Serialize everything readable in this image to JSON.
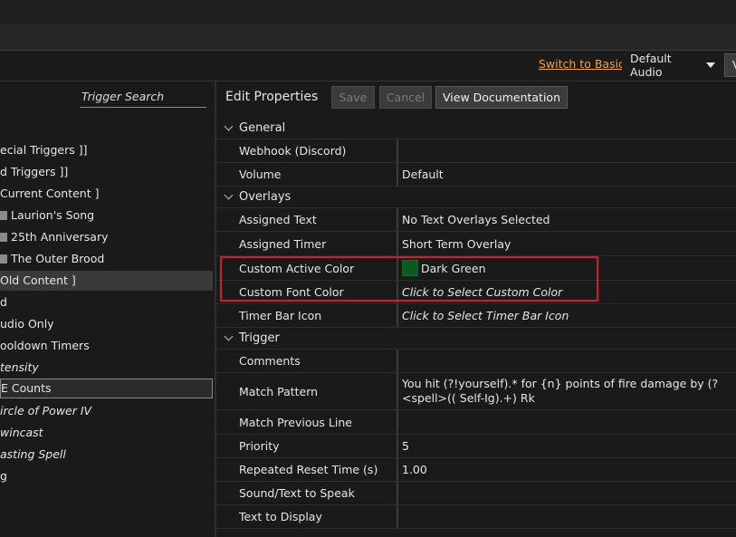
{
  "header": {
    "switch_basic": "Switch to Basic",
    "audio_selected": "Default Audio",
    "w_button": "V"
  },
  "left": {
    "search_placeholder": "Trigger Search",
    "items": [
      {
        "label": "ecial Triggers ]]"
      },
      {
        "label": "d Triggers ]]"
      },
      {
        "label": "Current Content ]"
      },
      {
        "label": "Laurion's Song"
      },
      {
        "label": "25th Anniversary"
      },
      {
        "label": "The Outer Brood"
      },
      {
        "label": "Old Content ]"
      },
      {
        "label": "d"
      },
      {
        "label": "udio Only"
      },
      {
        "label": "ooldown Timers"
      },
      {
        "label": "tensity"
      },
      {
        "label": "E Counts"
      },
      {
        "label": "ircle of Power IV"
      },
      {
        "label": "wincast"
      },
      {
        "label": "asting Spell"
      },
      {
        "label": "g"
      }
    ]
  },
  "edit": {
    "title": "Edit Properties",
    "save": "Save",
    "cancel": "Cancel",
    "view_doc": "View Documentation"
  },
  "sections": {
    "general": "General",
    "overlays": "Overlays",
    "trigger": "Trigger"
  },
  "props": {
    "webhook": {
      "name": "Webhook (Discord)",
      "value": ""
    },
    "volume": {
      "name": "Volume",
      "value": "Default"
    },
    "assigned_text": {
      "name": "Assigned Text",
      "value": "No Text Overlays Selected"
    },
    "assigned_timer": {
      "name": "Assigned Timer",
      "value": "Short Term Overlay"
    },
    "custom_active_color": {
      "name": "Custom Active Color",
      "value": "Dark Green",
      "swatch": "#0b5a1f"
    },
    "custom_font_color": {
      "name": "Custom Font Color",
      "value": "Click to Select Custom Color"
    },
    "timer_bar_icon": {
      "name": "Timer Bar Icon",
      "value": "Click to Select Timer Bar Icon"
    },
    "comments": {
      "name": "Comments",
      "value": ""
    },
    "match_pattern": {
      "name": "Match Pattern",
      "value": "You hit (?!yourself).* for {n} points of fire damage by (?<spell>(( Self-Ig).+) Rk"
    },
    "match_prev": {
      "name": "Match Previous Line",
      "value": ""
    },
    "priority": {
      "name": "Priority",
      "value": "5"
    },
    "repeat_reset": {
      "name": "Repeated Reset Time (s)",
      "value": "1.00"
    },
    "sound_text": {
      "name": "Sound/Text to Speak",
      "value": ""
    },
    "text_display": {
      "name": "Text to Display",
      "value": ""
    }
  },
  "colors": {
    "accent_link": "#f0a14b",
    "highlight_box": "#d11a2a"
  }
}
